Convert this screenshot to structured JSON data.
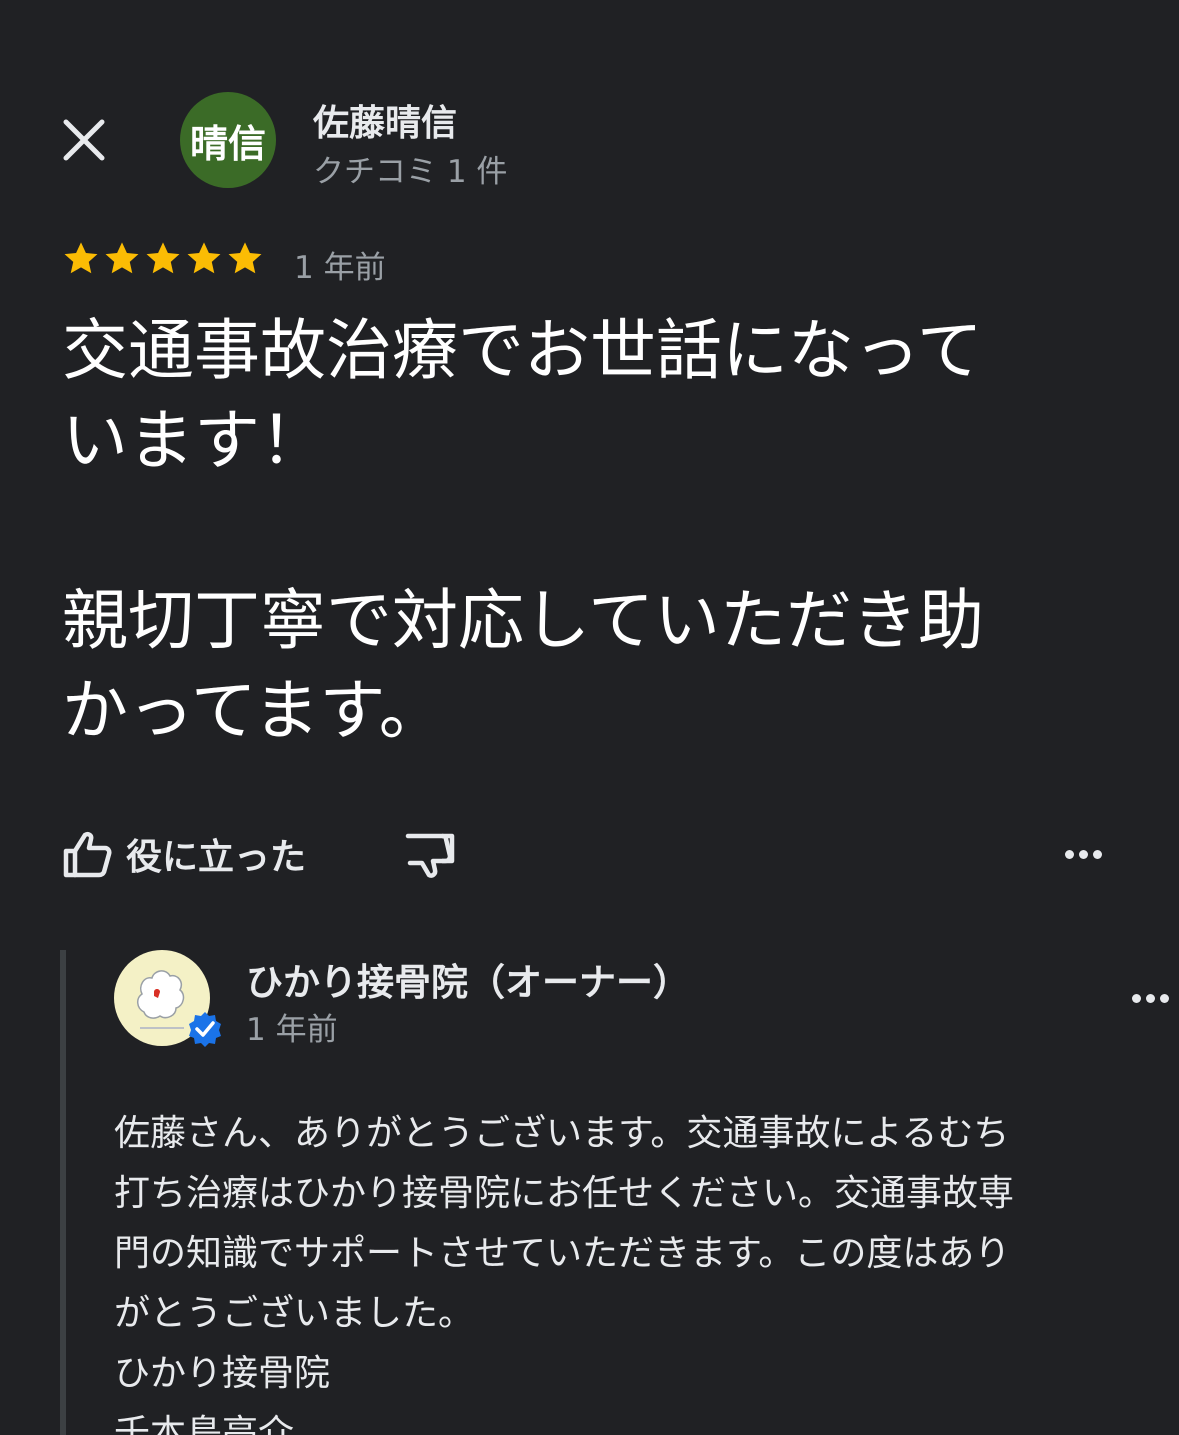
{
  "header": {
    "close_icon": "close-icon",
    "avatar_text": "晴信",
    "avatar_color": "#3b6b27",
    "reviewer_name": "佐藤晴信",
    "review_count": "クチコミ 1 件"
  },
  "review": {
    "rating": 5,
    "rating_max": 5,
    "star_color": "#fbbc04",
    "time": "1 年前",
    "text": "交通事故治療でお世話になって\nいます！\n\n親切丁寧で対応していただき助\nかってます。"
  },
  "actions": {
    "helpful_label": "役に立った",
    "thumbs_up_icon": "thumbs-up-icon",
    "thumbs_down_icon": "thumbs-down-icon",
    "more_icon": "more-horizontal-icon"
  },
  "owner_reply": {
    "name": "ひかり接骨院（オーナー）",
    "time": "1 年前",
    "verified_icon": "verified-badge-icon",
    "verified_color": "#1a73e8",
    "text": "佐藤さん、ありがとうございます。交通事故によるむち\n打ち治療はひかり接骨院にお任せください。交通事故専\n門の知識でサポートさせていただきます。この度はあり\nがとうございました。\nひかり接骨院\n千本島亮介"
  }
}
